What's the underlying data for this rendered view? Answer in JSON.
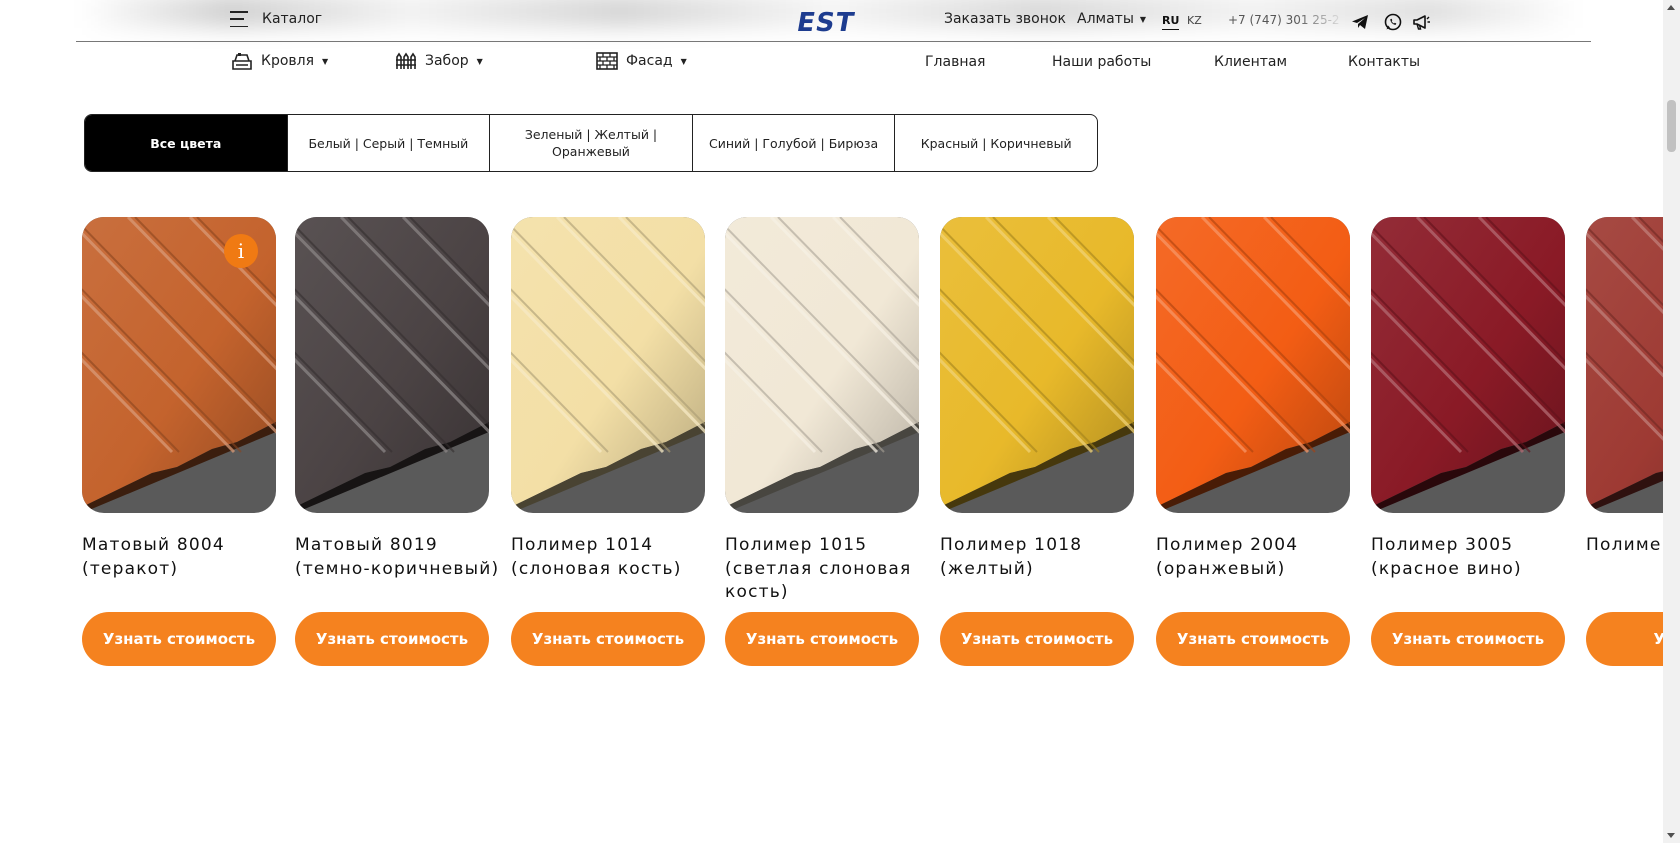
{
  "header": {
    "catalog_label": "Каталог",
    "logo_text": "EST",
    "callback_label": "Заказать звонок",
    "city_label": "Алматы",
    "lang_ru": "RU",
    "lang_kz": "KZ",
    "phone": "+7 (747) 301 25-2",
    "nav_dropdowns": [
      {
        "label": "Кровля",
        "icon": "roof-icon"
      },
      {
        "label": "Забор",
        "icon": "fence-icon"
      },
      {
        "label": "Фасад",
        "icon": "facade-icon"
      }
    ],
    "nav_links": [
      "Главная",
      "Наши работы",
      "Клиентам",
      "Контакты"
    ],
    "social_icons": [
      "telegram-icon",
      "whatsapp-icon",
      "megaphone-icon"
    ]
  },
  "filters": {
    "tabs": [
      "Все цвета",
      "Белый | Серый | Темный",
      "Зеленый | Желтый | Оранжевый",
      "Синий | Голубой | Бирюза",
      "Красный | Коричневый"
    ],
    "active": "Все цвета"
  },
  "products": [
    {
      "title": "Матовый 8004 (теракот)",
      "button": "Узнать стоимость",
      "color": "#c4632d",
      "info_badge": "i"
    },
    {
      "title": "Матовый 8019 (темно-коричневый)",
      "button": "Узнать стоимость",
      "color": "#4b4344"
    },
    {
      "title": "Полимер 1014 (слоновая кость)",
      "button": "Узнать стоимость",
      "color": "#f3dfa6"
    },
    {
      "title": "Полимер 1015 (светлая слоновая кость)",
      "button": "Узнать стоимость",
      "color": "#f1e8d6"
    },
    {
      "title": "Полимер 1018 (желтый)",
      "button": "Узнать стоимость",
      "color": "#e8b92a"
    },
    {
      "title": "Полимер 2004 (оранжевый)",
      "button": "Узнать стоимость",
      "color": "#f35d14"
    },
    {
      "title": "Полимер 3005 (красное вино)",
      "button": "Узнать стоимость",
      "color": "#8a1a26"
    },
    {
      "title": "Полимер (красна",
      "button": "Узнать",
      "color": "#9e3a33"
    }
  ],
  "colors": {
    "accent": "#f5821f",
    "logo": "#1d3c8f",
    "active_tab": "#000000"
  }
}
